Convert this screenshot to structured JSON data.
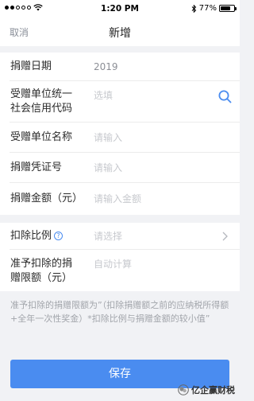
{
  "status_bar": {
    "time": "1:20 PM",
    "battery_text": "77%",
    "battery_level": 0.77
  },
  "nav": {
    "cancel_label": "取消",
    "title": "新增"
  },
  "form": {
    "donation_date": {
      "label": "捐赠日期",
      "value": "2019"
    },
    "credit_code": {
      "label_line1": "受赠单位统一",
      "label_line2": "社会信用代码",
      "placeholder": "选填"
    },
    "recipient_name": {
      "label": "受赠单位名称",
      "placeholder": "请输入"
    },
    "voucher_number": {
      "label": "捐赠凭证号",
      "placeholder": "请输入"
    },
    "donation_amount": {
      "label": "捐赠金额（元）",
      "placeholder": "请输入金额"
    },
    "deduction_ratio": {
      "label": "扣除比例",
      "help_glyph": "?",
      "placeholder": "请选择"
    },
    "deductible_limit": {
      "label_line1": "准予扣除的捐",
      "label_line2": "赠限额（元）",
      "placeholder": "自动计算"
    }
  },
  "note": "准予扣除的捐赠限额为”（扣除捐赠额之前的应纳税所得额+全年一次性奖金）*扣除比例与捐赠金额的较小值”",
  "save_label": "保存",
  "watermark": "亿企赢财税",
  "colors": {
    "accent": "#4a8cf0",
    "background": "#f1f2f5"
  }
}
